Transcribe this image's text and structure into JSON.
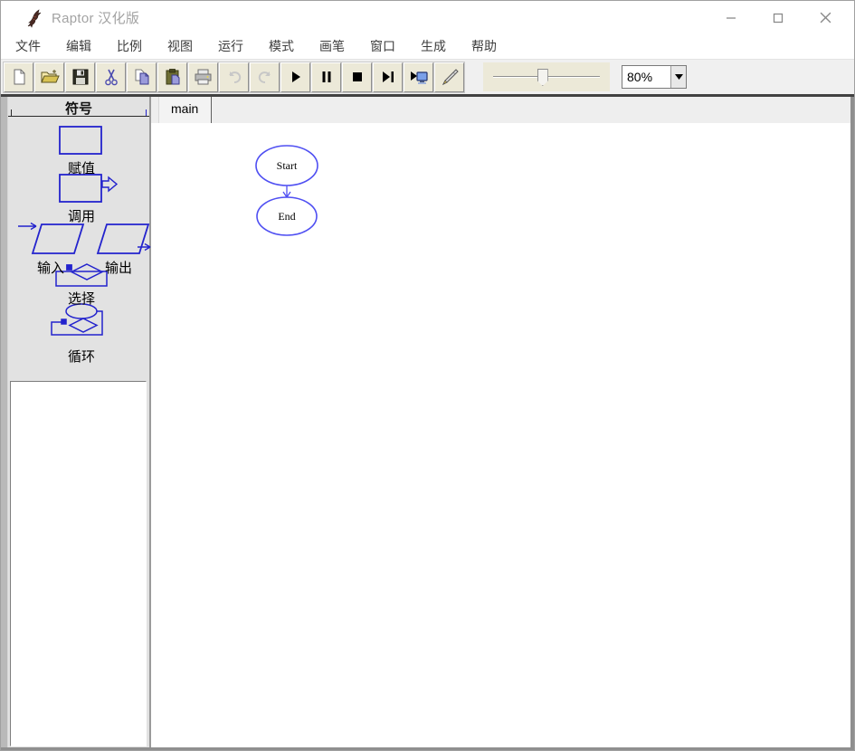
{
  "window": {
    "title": "Raptor 汉化版",
    "controls": {
      "minimize": "minimize",
      "maximize": "maximize",
      "close": "close"
    }
  },
  "menu": {
    "items": [
      "文件",
      "编辑",
      "比例",
      "视图",
      "运行",
      "模式",
      "画笔",
      "窗口",
      "生成",
      "帮助"
    ]
  },
  "toolbar": {
    "buttons": [
      "new",
      "open",
      "save",
      "cut",
      "copy",
      "paste",
      "print",
      "undo",
      "redo",
      "run",
      "pause",
      "stop",
      "step",
      "run-to-end",
      "pen"
    ],
    "disabled_buttons": [
      "undo",
      "redo"
    ],
    "zoom_value": "80%",
    "slider_position_percent": 47
  },
  "sidebar": {
    "header": "符号",
    "symbols": [
      {
        "id": "assignment",
        "label": "赋值"
      },
      {
        "id": "call",
        "label": "调用"
      },
      {
        "id": "input",
        "label": "输入"
      },
      {
        "id": "output",
        "label": "输出"
      },
      {
        "id": "selection",
        "label": "选择"
      },
      {
        "id": "loop",
        "label": "循环"
      }
    ]
  },
  "tabs": {
    "active": "main"
  },
  "flowchart": {
    "start_label": "Start",
    "end_label": "End"
  },
  "colors": {
    "symbol_stroke": "#2323cd",
    "flow_stroke": "#4f4ff2",
    "toolbar_face": "#ece9d8",
    "title_text": "#a3a3a3"
  }
}
